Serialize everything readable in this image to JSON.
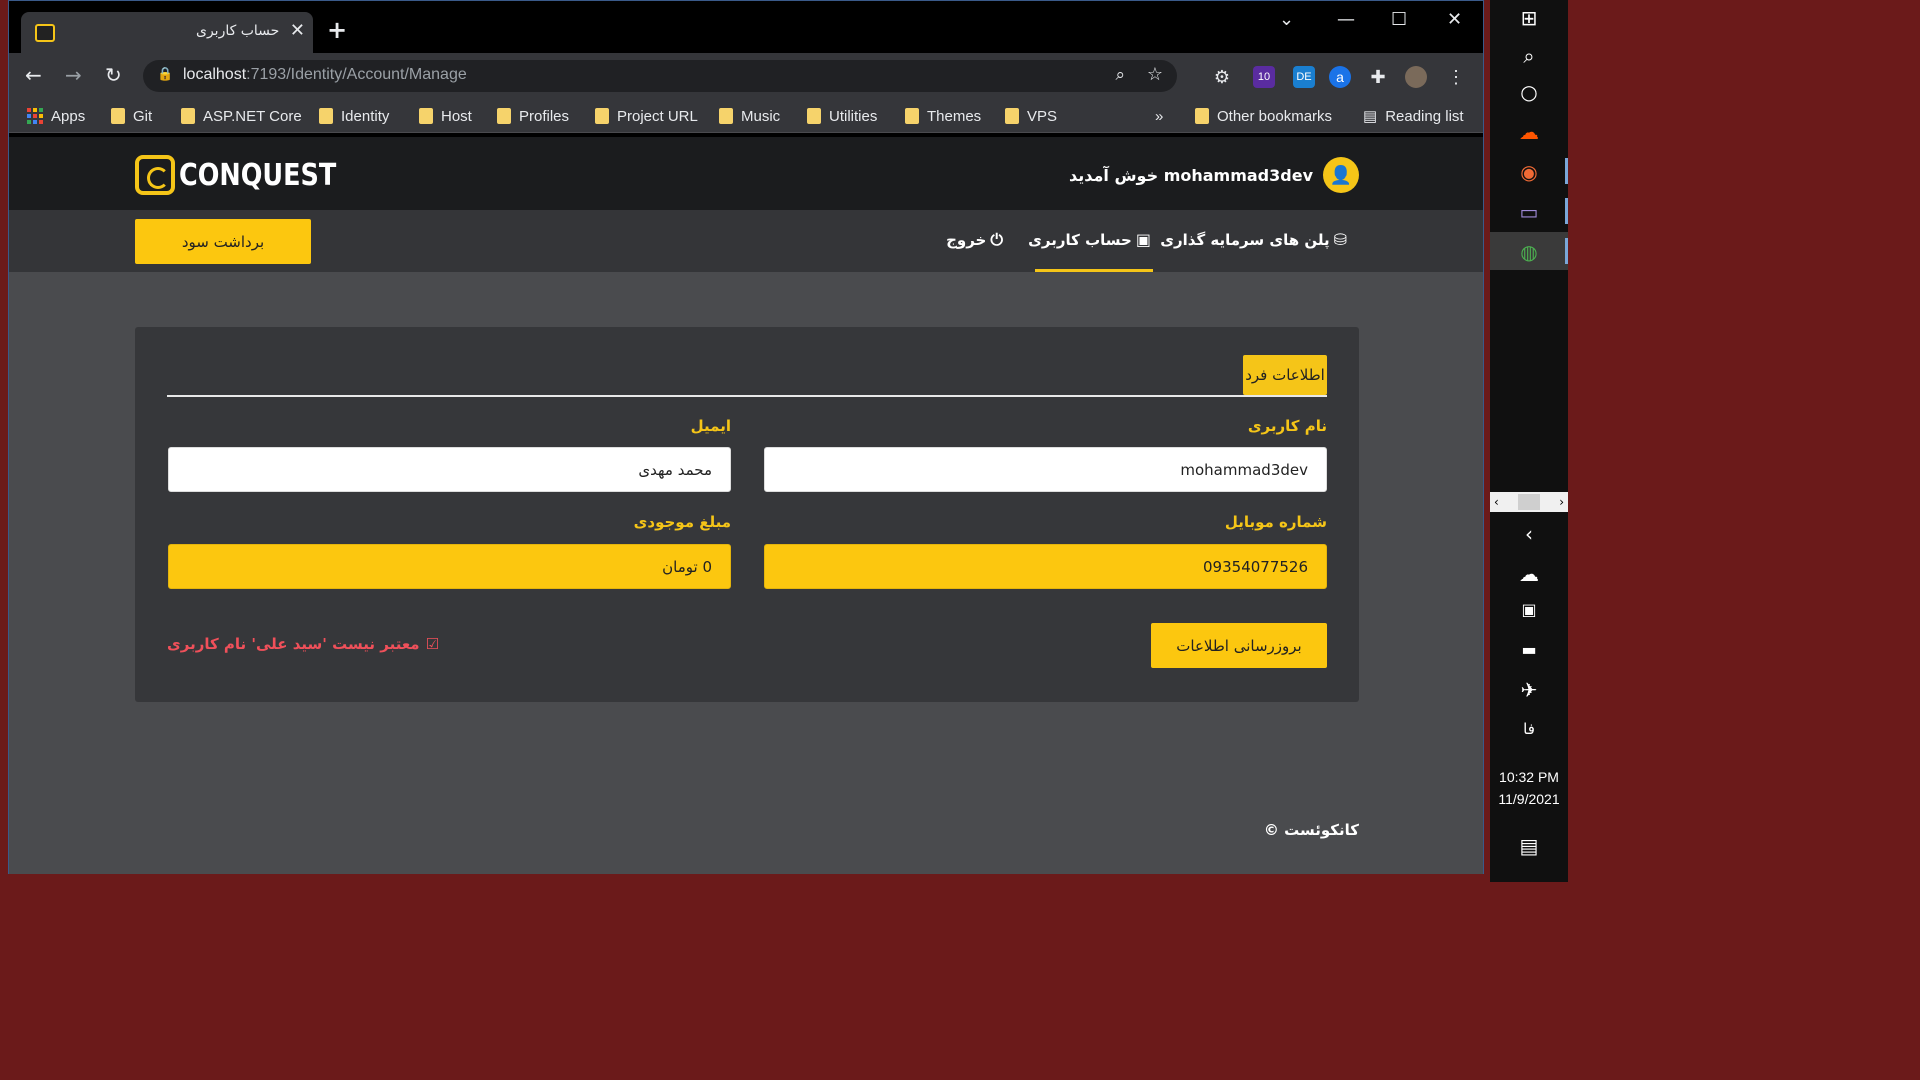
{
  "browser": {
    "tab_title": "حساب کاربری",
    "url_host": "localhost",
    "url_path": ":7193/Identity/Account/Manage",
    "bookmarks": [
      "Apps",
      "Git",
      "ASP.NET Core",
      "Identity",
      "Host",
      "Profiles",
      "Project URL",
      "Music",
      "Utilities",
      "Themes",
      "VPS"
    ],
    "more": "»",
    "other_bookmarks": "Other bookmarks",
    "reading_list": "Reading list",
    "ext_badge_1": "10",
    "ext_badge_2": "DE"
  },
  "header": {
    "logo_text": "CONQUEST",
    "welcome": "mohammad3dev خوش آمدید"
  },
  "menu": {
    "plans": "پلن های سرمایه گذاری",
    "account": "حساب کاربری",
    "logout": "خروج",
    "withdraw": "برداشت سود"
  },
  "form": {
    "section_title": "اطلاعات فرد",
    "username_label": "نام کاربری",
    "username_value": "mohammad3dev",
    "email_label": "ایمیل",
    "email_value": "محمد مهدی",
    "mobile_label": "شماره موبایل",
    "mobile_value": "09354077526",
    "balance_label": "مبلغ موجودی",
    "balance_value": "0 تومان",
    "update_button": "بروزرسانی اطلاعات",
    "error_message": "معتبر نیست 'سید علی' نام کاربری"
  },
  "footer": {
    "copyright": "کانکوئست ©"
  },
  "taskbar": {
    "lang": "فا",
    "time": "10:32 PM",
    "date": "11/9/2021"
  },
  "colors": {
    "accent": "#f5c518",
    "error": "#f0505a",
    "page_bg": "#4a4b4e",
    "card_bg": "#36373a",
    "header_bg": "#1b1c1e"
  }
}
